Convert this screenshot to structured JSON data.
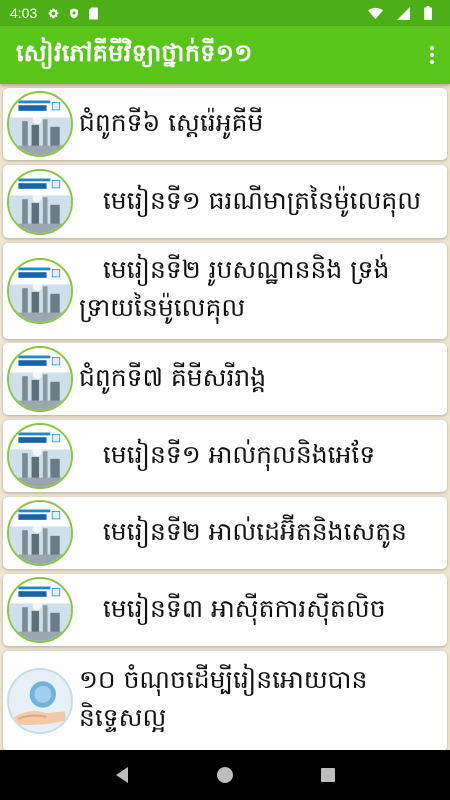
{
  "status_bar": {
    "time": "4:03",
    "icons_left": [
      "gear-icon",
      "shield-icon",
      "sd-card-icon"
    ],
    "icons_right": [
      "wifi-icon",
      "signal-icon",
      "battery-icon"
    ]
  },
  "app_bar": {
    "title": "សៀវភៅគីមីវិទ្យាថ្នាក់ទី១១",
    "menu_icon": "overflow-menu-icon"
  },
  "colors": {
    "status_bar": "#4caf17",
    "app_bar": "#59c51b",
    "background": "#efe6d2",
    "thumb_border": "#8bc34a"
  },
  "items": [
    {
      "text": "ជំពូកទី៦ ស្តេរ៉េអូគីមី",
      "thumb": "book-cover"
    },
    {
      "text": "   មេរៀនទី១ ធរណីមាត្រនៃម៉ូលេគុល",
      "thumb": "book-cover"
    },
    {
      "text": "   មេរៀនទី២ រូបសណ្ឋាននិង ទ្រង់ទ្រាយនៃម៉ូលេគុល",
      "thumb": "book-cover"
    },
    {
      "text": "ជំពូកទី៧ គីមីសរីរាង្គ",
      "thumb": "book-cover"
    },
    {
      "text": "   មេរៀនទី១ អាល់កុលនិងអេទែ",
      "thumb": "book-cover"
    },
    {
      "text": "   មេរៀនទី២ អាល់ដេអ៊ីតនិងសេតូន",
      "thumb": "book-cover"
    },
    {
      "text": "   មេរៀនទី៣ អាស៊ីតការស៊ីតលិច",
      "thumb": "book-cover"
    },
    {
      "text": "១០ ចំណុចដើម្បីរៀនអោយបាន និទ្ទេសល្អ",
      "thumb": "globe-hand"
    }
  ],
  "nav_bar": {
    "back": "back-icon",
    "home": "home-icon",
    "recents": "recents-icon"
  }
}
